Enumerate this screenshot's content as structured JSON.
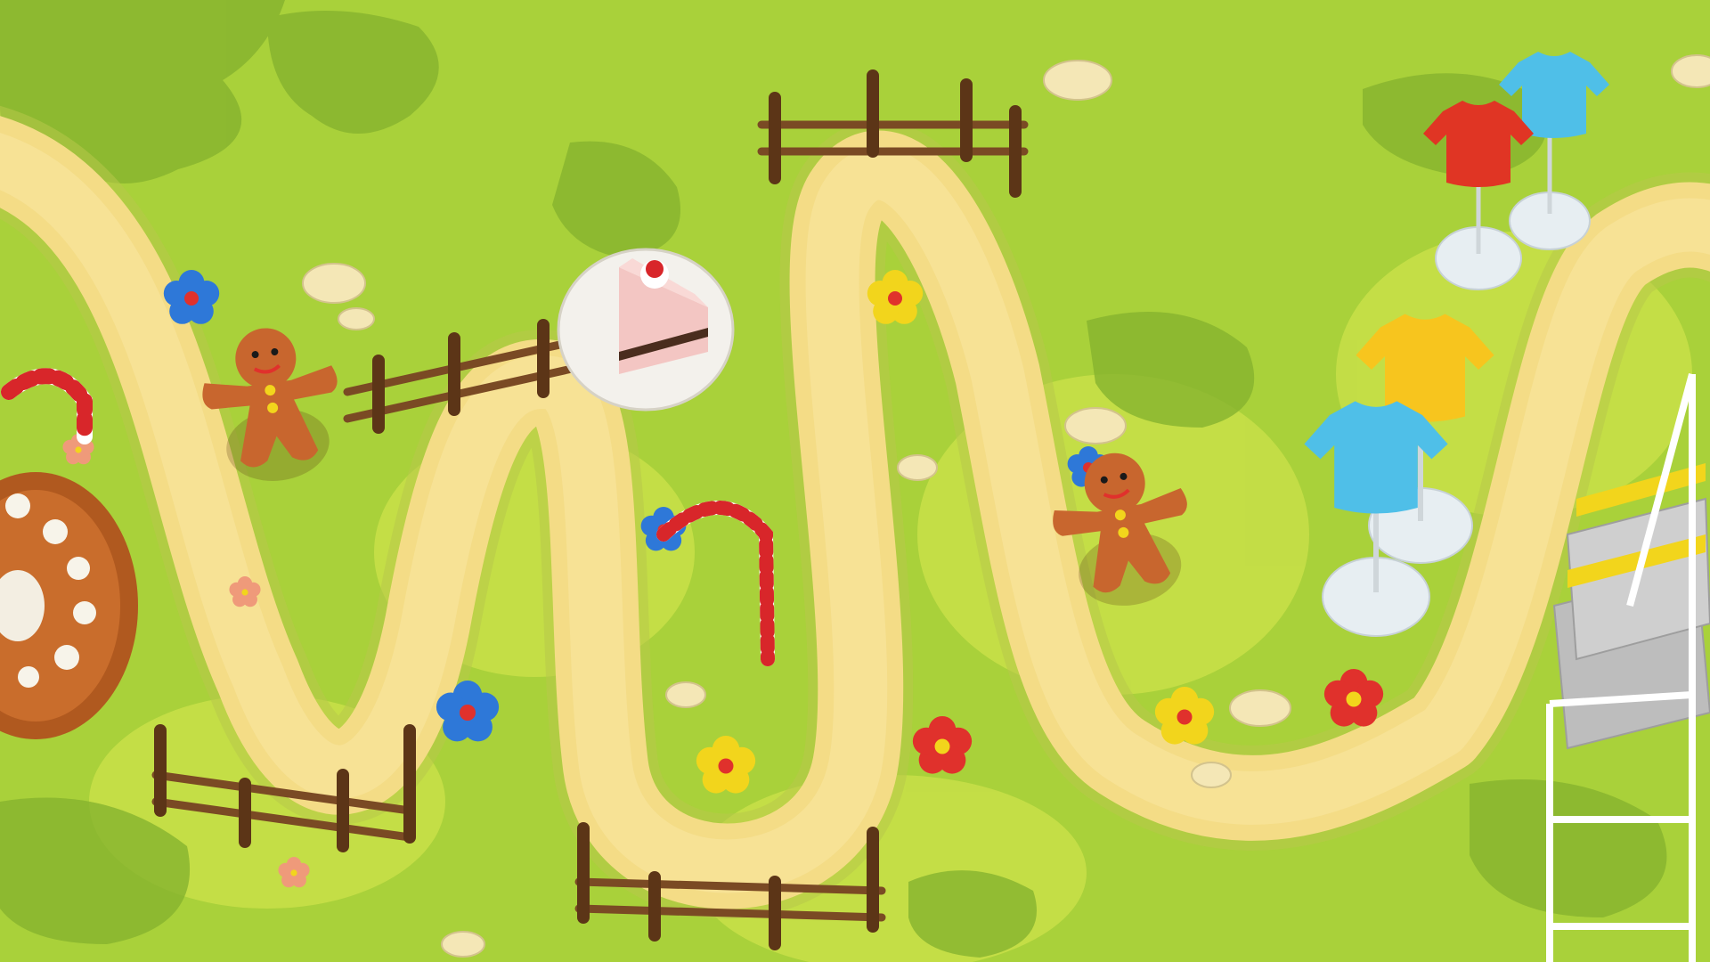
{
  "colors": {
    "grass": "#a9d13a",
    "grass_light": "#c8e04a",
    "grass_dark": "#84b12c",
    "bush": "#6f9e2a",
    "path_fill": "#f4dc86",
    "path_edge": "#d8be5e",
    "fence": "#7a4a24",
    "fence_dark": "#5c3517",
    "gingerbread": "#c8662e",
    "candy_red": "#d8262a",
    "shirt_red": "#e03524",
    "shirt_blue": "#4fbfe8",
    "shirt_yellow": "#f7c51e",
    "stand_base": "#e7eef2"
  },
  "icons": {
    "gingerbread": "gingerbread-man-icon",
    "cake": "cake-slice-icon",
    "candy_cane": "candy-cane-icon",
    "bundt_cake": "bundt-cake-icon",
    "shirt_stand": "shirt-mannequin-icon",
    "clothes_rack": "clothes-rack-icon",
    "flower": "flower-icon",
    "fence": "wooden-fence-icon"
  },
  "scene": {
    "items": [
      {
        "type": "bundt_cake"
      },
      {
        "type": "candy_cane"
      },
      {
        "type": "gingerbread"
      },
      {
        "type": "cake"
      },
      {
        "type": "candy_cane"
      },
      {
        "type": "gingerbread"
      },
      {
        "type": "shirt_stand",
        "color": "red"
      },
      {
        "type": "shirt_stand",
        "color": "blue"
      },
      {
        "type": "shirt_stand",
        "color": "yellow"
      },
      {
        "type": "shirt_stand",
        "color": "blue"
      },
      {
        "type": "clothes_rack"
      }
    ]
  }
}
